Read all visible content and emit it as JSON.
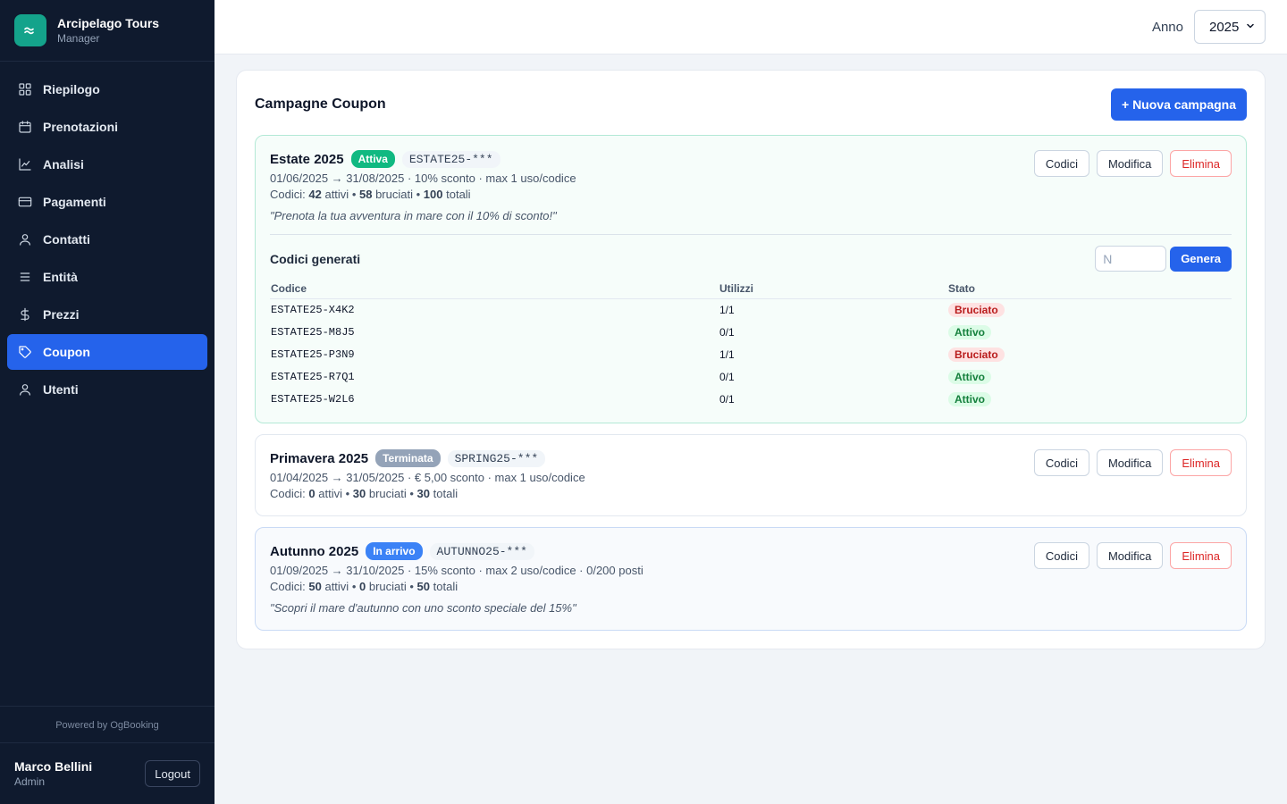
{
  "brand": {
    "name": "Arcipelago Tours",
    "subtitle": "Manager"
  },
  "sidebar": {
    "items": [
      {
        "label": "Riepilogo",
        "icon": "grid-icon"
      },
      {
        "label": "Prenotazioni",
        "icon": "calendar-icon"
      },
      {
        "label": "Analisi",
        "icon": "chart-icon"
      },
      {
        "label": "Pagamenti",
        "icon": "card-icon"
      },
      {
        "label": "Contatti",
        "icon": "user-icon"
      },
      {
        "label": "Entità",
        "icon": "list-icon"
      },
      {
        "label": "Prezzi",
        "icon": "dollar-icon"
      },
      {
        "label": "Coupon",
        "icon": "tag-icon",
        "active": true
      },
      {
        "label": "Utenti",
        "icon": "user-icon"
      }
    ],
    "powered_by": "Powered by OgBooking"
  },
  "user": {
    "name": "Marco Bellini",
    "role": "Admin",
    "logout_label": "Logout"
  },
  "topbar": {
    "year_label": "Anno",
    "year_value": "2025"
  },
  "main": {
    "title": "Campagne Coupon",
    "new_campaign_label": "+ Nuova campagna",
    "action_labels": {
      "codes": "Codici",
      "edit": "Modifica",
      "delete": "Elimina"
    },
    "campaigns": [
      {
        "name": "Estate 2025",
        "status": "Attiva",
        "prefix": "ESTATE25-***",
        "meta": "01/06/2025 → 31/08/2025  ·  10% sconto  ·  max 1 uso/codice",
        "codes_label": "Codici:",
        "active_count": "42",
        "active_label": "attivi",
        "burned_count": "58",
        "burned_label": "bruciati",
        "total_count": "100",
        "total_label": "totali",
        "message": "\"Prenota la tua avventura in mare con il 10% di sconto!\"",
        "generated": {
          "title": "Codici generati",
          "input_placeholder": "N",
          "generate_label": "Genera",
          "columns": [
            "Codice",
            "Utilizzi",
            "Stato"
          ],
          "rows": [
            {
              "code": "ESTATE25-X4K2",
              "uses": "1/1",
              "status": "Bruciato"
            },
            {
              "code": "ESTATE25-M8J5",
              "uses": "0/1",
              "status": "Attivo"
            },
            {
              "code": "ESTATE25-P3N9",
              "uses": "1/1",
              "status": "Bruciato"
            },
            {
              "code": "ESTATE25-R7Q1",
              "uses": "0/1",
              "status": "Attivo"
            },
            {
              "code": "ESTATE25-W2L6",
              "uses": "0/1",
              "status": "Attivo"
            }
          ]
        }
      },
      {
        "name": "Primavera 2025",
        "status": "Terminata",
        "prefix": "SPRING25-***",
        "meta": "01/04/2025 → 31/05/2025  ·  € 5,00 sconto  ·  max 1 uso/codice",
        "codes_label": "Codici:",
        "active_count": "0",
        "active_label": "attivi",
        "burned_count": "30",
        "burned_label": "bruciati",
        "total_count": "30",
        "total_label": "totali"
      },
      {
        "name": "Autunno 2025",
        "status": "In arrivo",
        "prefix": "AUTUNNO25-***",
        "meta": "01/09/2025 → 31/10/2025  ·  15% sconto  ·  max 2 uso/codice  ·  0/200 posti",
        "codes_label": "Codici:",
        "active_count": "50",
        "active_label": "attivi",
        "burned_count": "0",
        "burned_label": "bruciati",
        "total_count": "50",
        "total_label": "totali",
        "message": "\"Scopri il mare d'autunno con uno sconto speciale del 15%\""
      }
    ]
  },
  "colors": {
    "sidebar_bg": "#0f1a2e",
    "accent": "#2563eb",
    "brand": "#14a38b",
    "status_active": "#10b981",
    "status_ended": "#94a3b8",
    "status_upcoming": "#3b82f6"
  }
}
